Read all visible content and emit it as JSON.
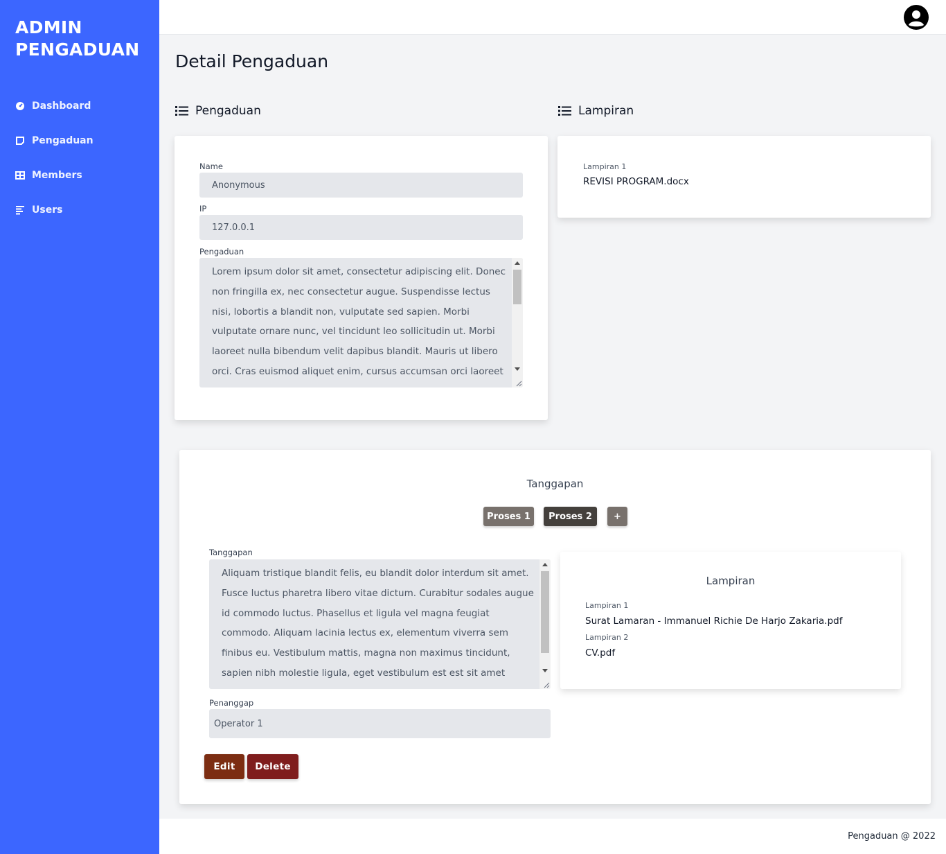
{
  "sidebar": {
    "brand_line1": "ADMIN",
    "brand_line2": "PENGADUAN",
    "items": [
      {
        "label": "Dashboard",
        "icon": "dashboard-icon"
      },
      {
        "label": "Pengaduan",
        "icon": "note-icon"
      },
      {
        "label": "Members",
        "icon": "table-icon"
      },
      {
        "label": "Users",
        "icon": "list-icon"
      }
    ],
    "bg_color": "#3c66ff"
  },
  "header": {
    "avatar_icon": "user-circle-icon"
  },
  "page": {
    "title": "Detail Pengaduan"
  },
  "pengaduan": {
    "heading": "Pengaduan",
    "name_label": "Name",
    "name_value": "Anonymous",
    "ip_label": "IP",
    "ip_value": "127.0.0.1",
    "text_label": "Pengaduan",
    "text_value": "Lorem ipsum dolor sit amet, consectetur adipiscing elit. Donec non fringilla ex, nec consectetur augue. Suspendisse lectus nisi, lobortis a blandit non, vulputate sed sapien. Morbi vulputate ornare nunc, vel tincidunt leo sollicitudin ut. Morbi laoreet nulla bibendum velit dapibus blandit. Mauris ut libero orci. Cras euismod aliquet enim, cursus accumsan orci laoreet"
  },
  "lampiran": {
    "heading": "Lampiran",
    "items": [
      {
        "label": "Lampiran 1",
        "value": "REVISI PROGRAM.docx"
      }
    ]
  },
  "tanggapan": {
    "title": "Tanggapan",
    "tabs": [
      {
        "label": "Proses 1",
        "color": "#78716c"
      },
      {
        "label": "Proses 2",
        "color": "#44403c"
      },
      {
        "label": "+",
        "color": "#78716c"
      }
    ],
    "text_label": "Tanggapan",
    "text_value": "Aliquam tristique blandit felis, eu blandit dolor interdum sit amet. Fusce luctus pharetra libero vitae dictum. Curabitur sodales augue id commodo luctus. Phasellus et ligula vel magna feugiat commodo. Aliquam lacinia lectus ex, elementum viverra sem finibus eu. Vestibulum mattis, magna non maximus tincidunt, sapien nibh molestie ligula, eget vestibulum est est sit amet",
    "responder_label": "Penanggap",
    "responder_value": "Operator 1",
    "edit_label": "Edit",
    "delete_label": "Delete",
    "edit_color": "#7c2d12",
    "delete_color": "#7f1d1d",
    "lampiran_title": "Lampiran",
    "lampiran_items": [
      {
        "label": "Lampiran 1",
        "value": "Surat Lamaran - Immanuel Richie De Harjo Zakaria.pdf"
      },
      {
        "label": "Lampiran 2",
        "value": "CV.pdf"
      }
    ]
  },
  "footer": {
    "text": "Pengaduan @ 2022"
  }
}
